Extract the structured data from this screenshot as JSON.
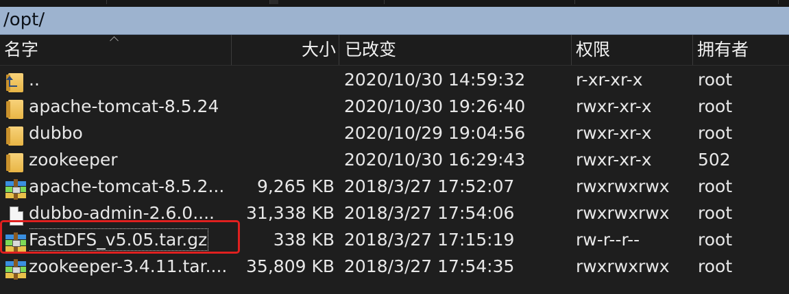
{
  "path": "/opt/",
  "columns": {
    "name": "名字",
    "size": "大小",
    "modified": "已改变",
    "permissions": "权限",
    "owner": "拥有者"
  },
  "rows": [
    {
      "name": "..",
      "size": "",
      "modified": "2020/10/30 14:59:32",
      "permissions": "r-xr-xr-x",
      "owner": "root",
      "icon": "parent-folder-icon"
    },
    {
      "name": "apache-tomcat-8.5.24",
      "size": "",
      "modified": "2020/10/30 19:26:40",
      "permissions": "rwxr-xr-x",
      "owner": "root",
      "icon": "folder-icon"
    },
    {
      "name": "dubbo",
      "size": "",
      "modified": "2020/10/29 19:04:56",
      "permissions": "rwxr-xr-x",
      "owner": "root",
      "icon": "folder-icon"
    },
    {
      "name": "zookeeper",
      "size": "",
      "modified": "2020/10/30 16:29:43",
      "permissions": "rwxr-xr-x",
      "owner": "502",
      "icon": "folder-icon"
    },
    {
      "name": "apache-tomcat-8.5.2...",
      "size": "9,265 KB",
      "modified": "2018/3/27 17:52:07",
      "permissions": "rwxrwxrwx",
      "owner": "root",
      "icon": "archive-icon"
    },
    {
      "name": "dubbo-admin-2.6.0....",
      "size": "31,338 KB",
      "modified": "2018/3/27 17:54:06",
      "permissions": "rwxrwxrwx",
      "owner": "root",
      "icon": "file-icon"
    },
    {
      "name": "FastDFS_v5.05.tar.gz",
      "size": "338 KB",
      "modified": "2018/3/27 17:15:19",
      "permissions": "rw-r--r--",
      "owner": "root",
      "icon": "archive-icon"
    },
    {
      "name": "zookeeper-3.4.11.tar....",
      "size": "35,809 KB",
      "modified": "2018/3/27 17:54:35",
      "permissions": "rwxrwxrwx",
      "owner": "root",
      "icon": "archive-icon"
    }
  ],
  "colors": {
    "path_bar": "#9db3cf",
    "background": "#1e1e1e",
    "highlight": "#e0201f"
  }
}
